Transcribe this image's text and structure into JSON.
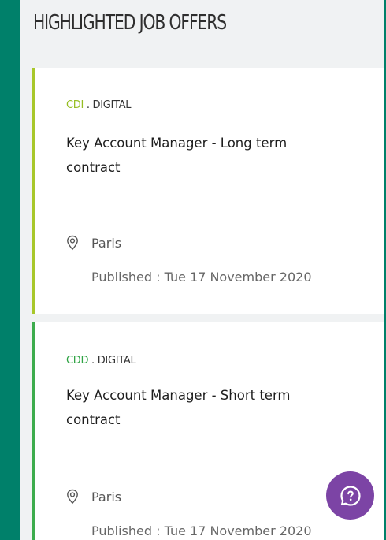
{
  "section": {
    "title": "HIGHLIGHTED JOB OFFERS"
  },
  "colors": {
    "background_teal": "#00806a",
    "cdi_accent": "#a8c72a",
    "cdd_accent": "#3dac4d",
    "help_button": "#7c44a5"
  },
  "offers": [
    {
      "contract_type": "CDI",
      "category": " . DIGITAL",
      "title": "Key Account Manager - Long term contract",
      "location": "Paris",
      "published": "Published : Tue 17 November 2020"
    },
    {
      "contract_type": "CDD",
      "category": " . DIGITAL",
      "title": "Key Account Manager - Short term contract",
      "location": "Paris",
      "published": "Published : Tue 17 November 2020"
    }
  ],
  "icons": {
    "location": "location-pin-icon",
    "help": "help-chat-icon"
  }
}
